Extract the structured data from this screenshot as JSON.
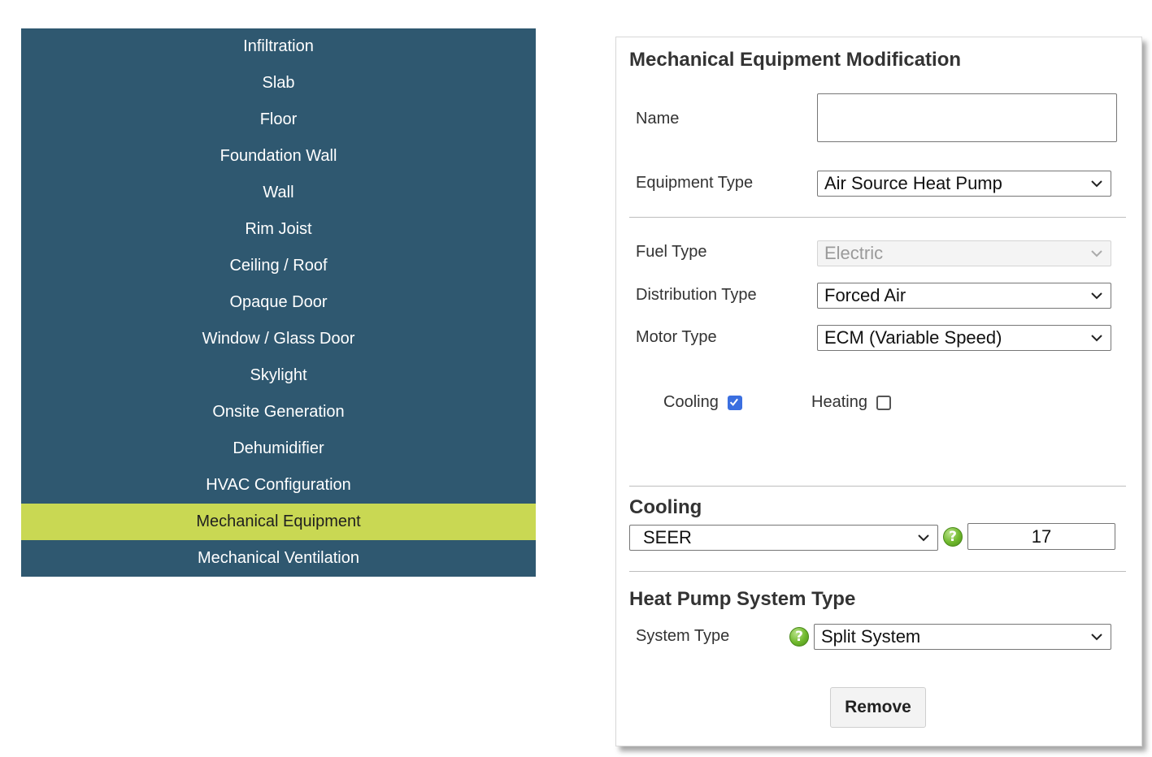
{
  "sidebar": {
    "items": [
      {
        "label": "Infiltration"
      },
      {
        "label": "Slab"
      },
      {
        "label": "Floor"
      },
      {
        "label": "Foundation Wall"
      },
      {
        "label": "Wall"
      },
      {
        "label": "Rim Joist"
      },
      {
        "label": "Ceiling / Roof"
      },
      {
        "label": "Opaque Door"
      },
      {
        "label": "Window / Glass Door"
      },
      {
        "label": "Skylight"
      },
      {
        "label": "Onsite Generation"
      },
      {
        "label": "Dehumidifier"
      },
      {
        "label": "HVAC Configuration"
      },
      {
        "label": "Mechanical Equipment",
        "active": true
      },
      {
        "label": "Mechanical Ventilation"
      }
    ]
  },
  "panel": {
    "title": "Mechanical Equipment Modification",
    "name_label": "Name",
    "name_value": "",
    "equipment_type_label": "Equipment Type",
    "equipment_type_value": "Air Source Heat Pump",
    "fuel_type_label": "Fuel Type",
    "fuel_type_value": "Electric",
    "distribution_type_label": "Distribution Type",
    "distribution_type_value": "Forced Air",
    "motor_type_label": "Motor Type",
    "motor_type_value": "ECM (Variable Speed)",
    "cooling_checkbox_label": "Cooling",
    "cooling_checked": true,
    "heating_checkbox_label": "Heating",
    "heating_checked": false,
    "cooling_section_title": "Cooling",
    "efficiency_metric_value": "SEER",
    "efficiency_value": "17",
    "heat_pump_section_title": "Heat Pump System Type",
    "system_type_label": "System Type",
    "system_type_value": "Split System",
    "help_glyph": "?",
    "remove_label": "Remove"
  },
  "colors": {
    "sidebar_bg": "#2f5870",
    "sidebar_active_bg": "#c9d853",
    "checkbox_checked": "#3b6fe0",
    "help_icon_green": "#6fb82c"
  },
  "icons": {
    "select_arrow": "chevron-down-icon",
    "help": "help-icon",
    "check": "checkmark-icon"
  }
}
